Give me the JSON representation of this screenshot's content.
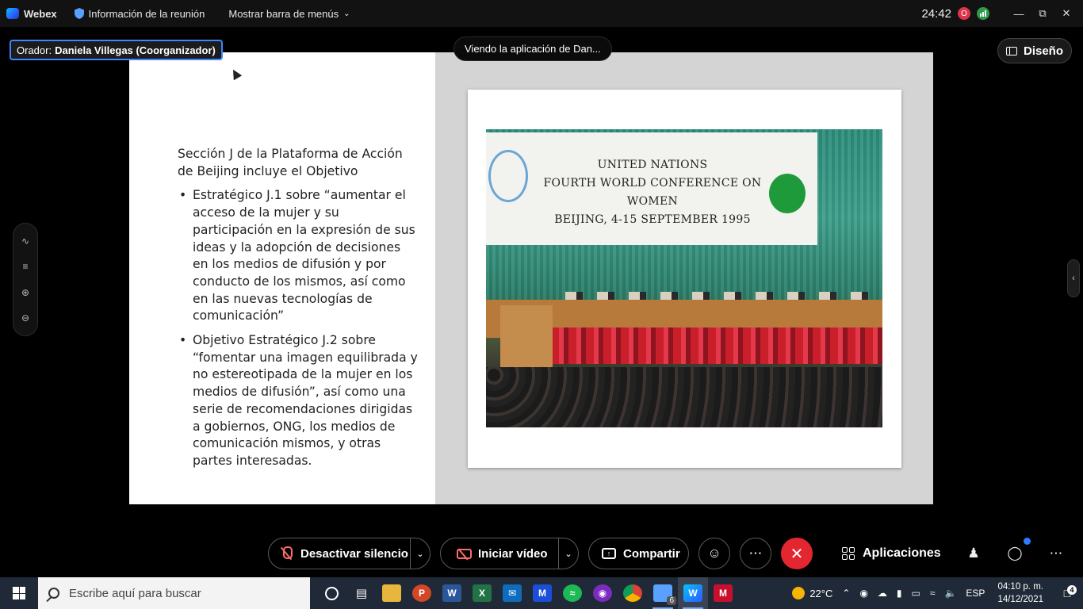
{
  "titlebar": {
    "app_name": "Webex",
    "meeting_info": "Información de la reunión",
    "menu_toggle": "Mostrar barra de menús",
    "timer": "24:42",
    "rec_letter": "O"
  },
  "speaker": {
    "prefix": "Orador:",
    "name": "Daniela Villegas (Coorganizador)"
  },
  "viewing": "Viendo la aplicación de Dan...",
  "layout_button": "Diseño",
  "slide": {
    "intro": "Sección J de la Plataforma de Acción de Beijing incluye el Objetivo",
    "bullets": [
      "Estratégico J.1 sobre “aumentar el acceso de la mujer y su participación en la expresión de sus ideas y la adopción de decisiones en los medios de difusión y por conducto de los mismos, así como en las nuevas tecnologías de comunicación”",
      "Objetivo Estratégico J.2 sobre “fomentar una imagen equilibrada y no estereotipada de la mujer en los medios de difusión”, así como una serie de recomendaciones dirigidas a gobiernos, ONG, los medios de comunicación mismos, y otras partes interesadas."
    ],
    "photo_banner": [
      "UNITED NATIONS",
      "FOURTH WORLD CONFERENCE ON WOMEN",
      "BEIJING, 4-15 SEPTEMBER 1995"
    ]
  },
  "controls": {
    "mute_label": "Desactivar silencio",
    "video_label": "Iniciar vídeo",
    "share_label": "Compartir",
    "apps_label": "Aplicaciones"
  },
  "taskbar": {
    "search_placeholder": "Escribe aquí para buscar",
    "badge_count": "6",
    "temperature": "22°C",
    "language": "ESP",
    "time": "04:10 p. m.",
    "date": "14/12/2021",
    "notification_count": "4"
  },
  "colors": {
    "accent_blue": "#3c86ff",
    "end_call_red": "#e3262f",
    "muted_red": "#ff6b6b"
  }
}
